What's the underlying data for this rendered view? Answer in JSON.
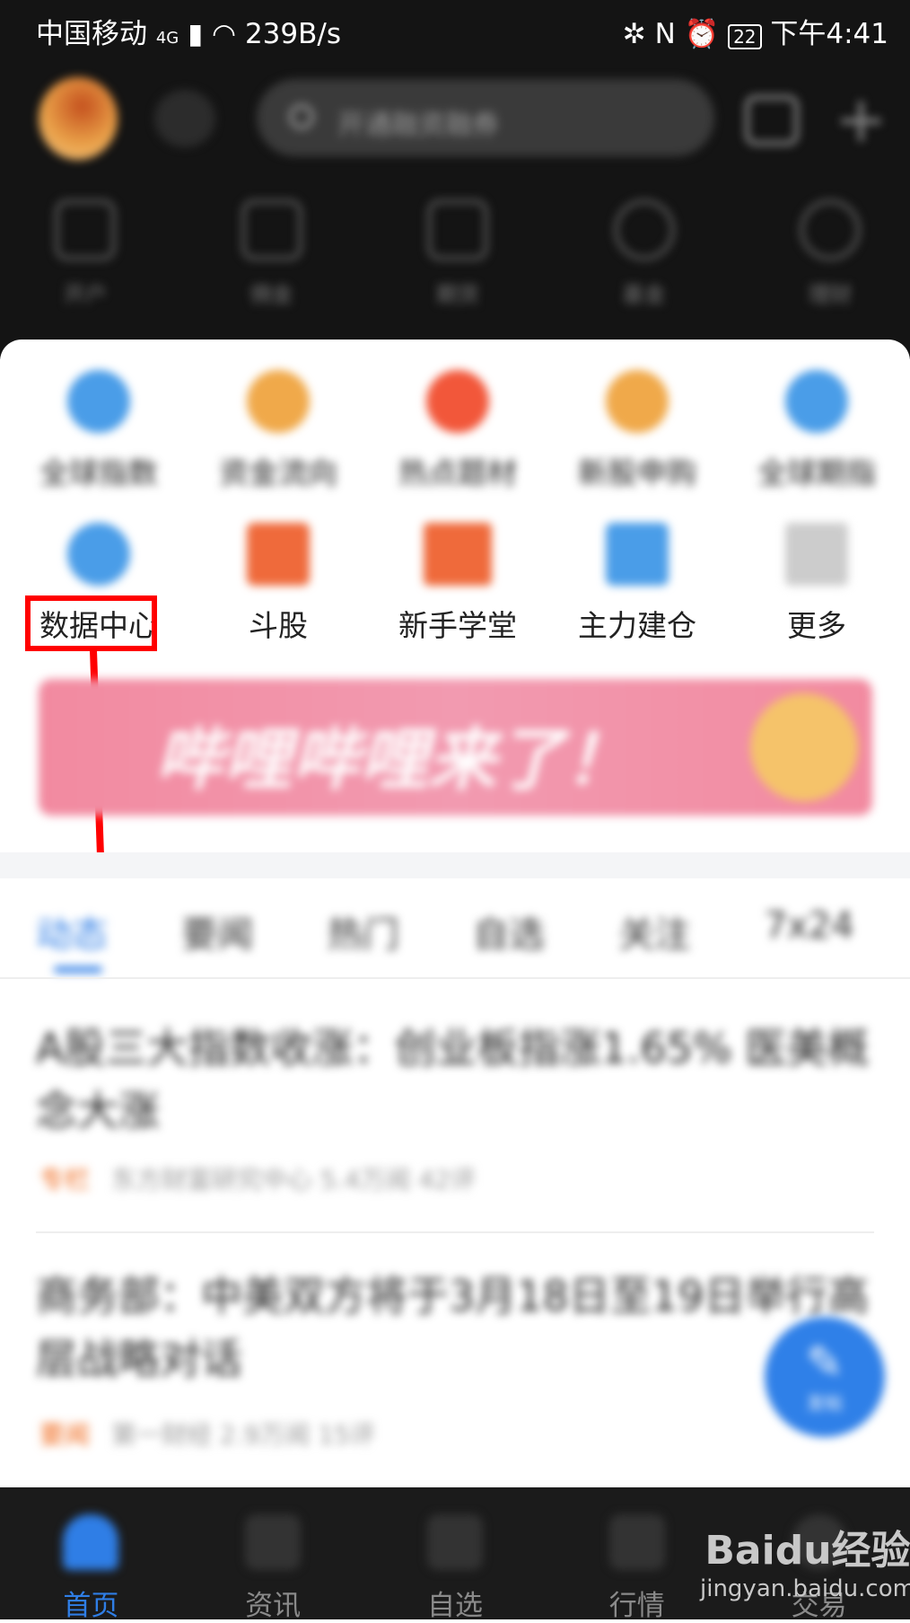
{
  "status_bar": {
    "carrier": "中国移动",
    "network": "4G",
    "speed": "239B/s",
    "battery": "22",
    "time": "下午4:41"
  },
  "header": {
    "search_placeholder": "开通融资融券"
  },
  "top_row": [
    {
      "label": "开户"
    },
    {
      "label": "佣金"
    },
    {
      "label": "期货"
    },
    {
      "label": "基金"
    },
    {
      "label": "理财"
    }
  ],
  "grid_row1": [
    {
      "label": "全球指数",
      "color": "#4a9de8"
    },
    {
      "label": "资金流向",
      "color": "#f0a94a"
    },
    {
      "label": "热点题材",
      "color": "#f2573a"
    },
    {
      "label": "新股申购",
      "color": "#f0a94a"
    },
    {
      "label": "全球期指",
      "color": "#4a9de8"
    }
  ],
  "grid_row2": [
    {
      "label": "数据中心",
      "color": "#4a9de8"
    },
    {
      "label": "斗股",
      "color": "#ef6a3b"
    },
    {
      "label": "新手学堂",
      "color": "#ef6a3b"
    },
    {
      "label": "主力建仓",
      "color": "#4a9de8"
    },
    {
      "label": "更多",
      "color": "#cccccc"
    }
  ],
  "banner": {
    "text": "哔哩哔哩来了！"
  },
  "feed_tabs": [
    {
      "label": "动态",
      "active": true
    },
    {
      "label": "要闻"
    },
    {
      "label": "热门"
    },
    {
      "label": "自选"
    },
    {
      "label": "关注"
    },
    {
      "label": "7x24"
    }
  ],
  "news": [
    {
      "title": "A股三大指数收涨：创业板指涨1.65% 医美概念大涨",
      "tag": "专栏",
      "meta": "东方财富研究中心 5.4万阅 42评"
    },
    {
      "title": "商务部：中美双方将于3月18日至19日举行高层战略对话",
      "tag": "要闻",
      "meta": "第一财经 2.9万阅 15评"
    }
  ],
  "fab": {
    "label": "发帖"
  },
  "bottom_nav": [
    {
      "label": "首页",
      "active": true
    },
    {
      "label": "资讯"
    },
    {
      "label": "自选"
    },
    {
      "label": "行情"
    },
    {
      "label": "交易"
    }
  ],
  "watermark": {
    "brand": "Baidu经验",
    "url": "jingyan.baidu.com"
  },
  "colors": {
    "accent": "#2f7ee6",
    "highlight": "#ff0000",
    "banner": "#f28aa0"
  }
}
